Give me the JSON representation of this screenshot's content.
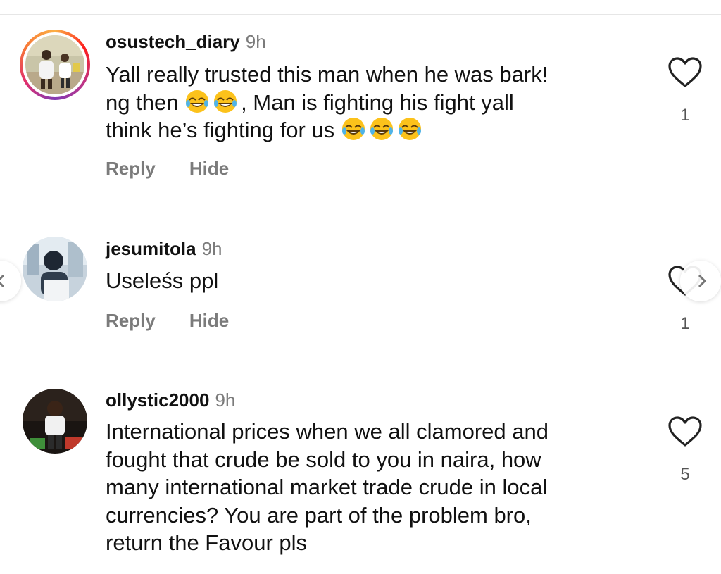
{
  "comments": [
    {
      "username": "osustech_diary",
      "time": "9h",
      "lines": [
        "Yall really trusted this man when he was bark!",
        "ng then",
        ", Man is fighting his fight yall",
        "think he’s fighting for us"
      ],
      "reply_label": "Reply",
      "hide_label": "Hide",
      "likes": "1",
      "has_story_ring": true
    },
    {
      "username": "jesumitola",
      "time": "9h",
      "lines": [
        "Useleśs ppl"
      ],
      "reply_label": "Reply",
      "hide_label": "Hide",
      "likes": "1",
      "has_story_ring": false
    },
    {
      "username": "ollystic2000",
      "time": "9h",
      "lines": [
        "International prices when we all clamored and",
        "fought that crude be sold to you in naira, how",
        "many international market trade crude in local",
        "currencies? You are part of the problem bro,",
        "return the Favour pls"
      ],
      "likes": "5",
      "has_story_ring": false
    }
  ],
  "icons": {
    "like": "heart-outline-icon",
    "emoji": "face-with-tears-of-joy-icon",
    "next": "chevron-right-icon",
    "prev": "chevron-left-icon"
  },
  "colors": {
    "text": "#111111",
    "muted": "#7b7b7b",
    "divider": "#e6e6e6"
  }
}
